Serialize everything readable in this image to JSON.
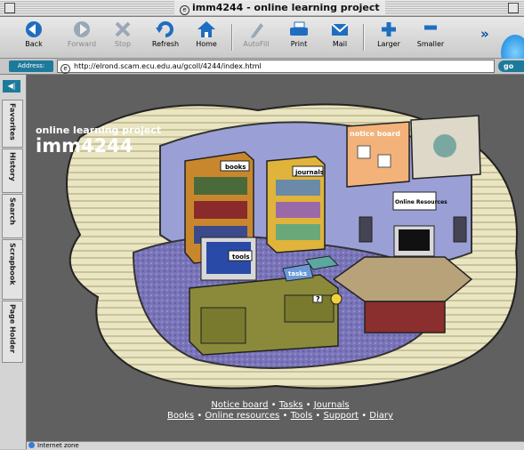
{
  "window": {
    "title": "imm4244 - online learning project"
  },
  "toolbar": {
    "buttons": [
      {
        "label": "Back",
        "icon": "back-arrow-icon"
      },
      {
        "label": "Forward",
        "icon": "forward-arrow-icon"
      },
      {
        "label": "Stop",
        "icon": "stop-icon"
      },
      {
        "label": "Refresh",
        "icon": "refresh-icon"
      },
      {
        "label": "Home",
        "icon": "home-icon"
      },
      {
        "label": "AutoFill",
        "icon": "autofill-icon"
      },
      {
        "label": "Print",
        "icon": "print-icon"
      },
      {
        "label": "Mail",
        "icon": "mail-icon"
      },
      {
        "label": "Larger",
        "icon": "larger-icon"
      },
      {
        "label": "Smaller",
        "icon": "smaller-icon"
      }
    ],
    "overflow": "»"
  },
  "address": {
    "label": "Address:",
    "url": "http://elrond.scam.ecu.edu.au/gcoll/4244/index.html",
    "go": "go"
  },
  "sidebar": {
    "tabs": [
      "Favorites",
      "History",
      "Search",
      "Scrapbook",
      "Page Holder"
    ]
  },
  "page": {
    "heading_sub": "online learning project",
    "heading_main": "imm4244",
    "scene_labels": {
      "books": "books",
      "journals": "journals",
      "notice_board": "notice board",
      "online_resources": "Online Resources",
      "tools": "tools",
      "tasks": "tasks",
      "help": "?"
    },
    "links_row1": [
      "Notice board",
      "Tasks",
      "Journals"
    ],
    "links_row2": [
      "Books",
      "Online resources",
      "Tools",
      "Support",
      "Diary"
    ],
    "separator": " • "
  },
  "status": {
    "text": "Internet zone"
  },
  "colors": {
    "accent": "#1e7a9a",
    "page_bg": "#606060",
    "scene_beige": "#eae5c2",
    "scene_blue": "#9aa0d6"
  }
}
